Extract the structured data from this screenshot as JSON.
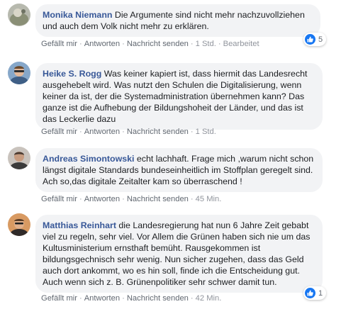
{
  "comments": [
    {
      "author": "Monika Niemann",
      "text": " Die Argumente sind nicht mehr nachzuvollziehen und auch dem Volk nicht mehr zu erklären.",
      "like": "Gefällt mir",
      "reply": "Antworten",
      "message": "Nachricht senden",
      "time": "1 Std.",
      "edited": "Bearbeitet",
      "reaction_count": "5",
      "avatar_color": "#8a8f76"
    },
    {
      "author": "Heike S. Rogg",
      "text": " Was keiner kapiert ist, dass hiermit das Landesrecht ausgehebelt wird. Was nutzt den Schulen die Digitalisierung, wenn keiner da ist, der die Systemadministration übernehmen kann? Das ganze ist die Aufhebung der Bildungshoheit der Länder, und das ist das Leckerlie dazu",
      "like": "Gefällt mir",
      "reply": "Antworten",
      "message": "Nachricht senden",
      "time": "1 Std.",
      "avatar_color": "#5d7fa3"
    },
    {
      "author": "Andreas Simontowski",
      "text": " echt lachhaft. Frage mich ,warum nicht schon längst digitale Standards bundeseinheitlich im Stoffplan geregelt sind. Ach so,das digitale Zeitalter kam so überraschend !",
      "like": "Gefällt mir",
      "reply": "Antworten",
      "message": "Nachricht senden",
      "time": "45 Min.",
      "avatar_color": "#6b5a50"
    },
    {
      "author": "Matthias Reinhart",
      "text": " die Landesregierung hat nun 6 Jahre Zeit gebabt viel zu regeln, sehr viel. Vor Allem die Grünen haben sich nie um das Kultusministerium ernsthaft bemüht. Rausgekommen ist bildungsgechnisch sehr wenig. Nun sicher zugehen, dass das Geld auch dort ankommt, wo es hin soll, finde ich die Entscheidung gut. Auch wenn sich z. B. Grünenpolitiker sehr schwer damit tun.",
      "like": "Gefällt mir",
      "reply": "Antworten",
      "message": "Nachricht senden",
      "time": "42 Min.",
      "reaction_count": "1",
      "avatar_color": "#a4623a"
    }
  ],
  "colors": {
    "author": "#385898",
    "bubble": "#f2f3f5",
    "meta": "#90949c",
    "like_blue": "#1877f2"
  },
  "icons": {
    "reaction": "thumbs-up-icon"
  }
}
